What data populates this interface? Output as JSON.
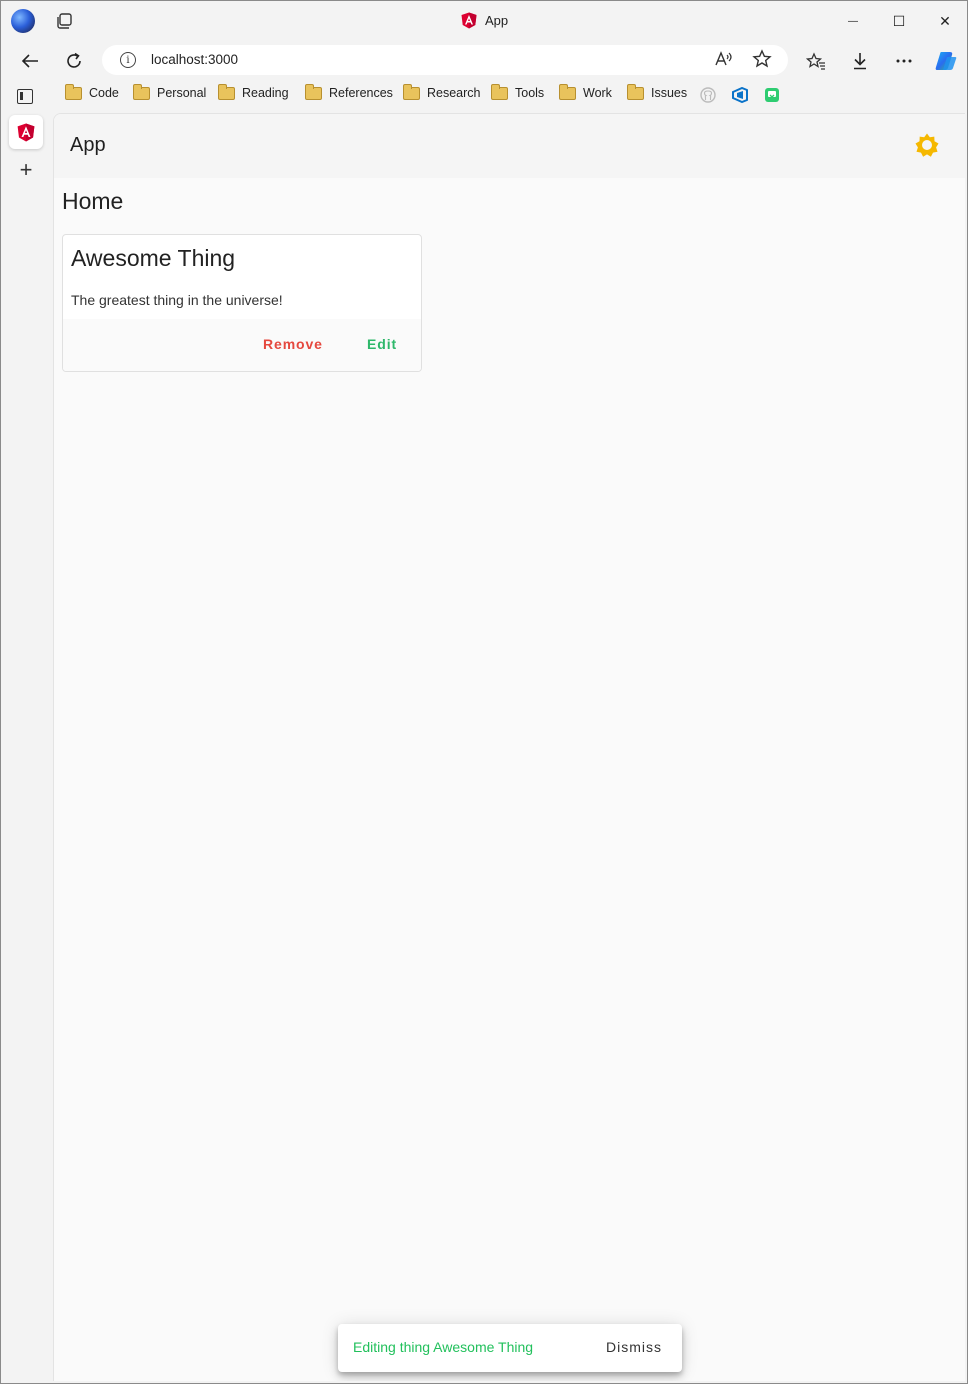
{
  "browser": {
    "tab_title": "App",
    "url": "localhost:3000",
    "window_controls": {
      "minimize": "—",
      "maximize": "☐",
      "close": "✕"
    },
    "bookmarks": [
      "Code",
      "Personal",
      "Reading",
      "References",
      "Research",
      "Tools",
      "Work",
      "Issues"
    ],
    "new_tab_glyph": "+"
  },
  "app": {
    "title": "App",
    "page_title": "Home",
    "card": {
      "title": "Awesome Thing",
      "description": "The greatest thing in the universe!",
      "remove_label": "Remove",
      "edit_label": "Edit"
    },
    "snackbar": {
      "message": "Editing thing Awesome Thing",
      "action_label": "Dismiss"
    }
  },
  "colors": {
    "remove": "#e5483e",
    "edit": "#2eb86a",
    "snackbar_message": "#22c05c",
    "theme_icon": "#f5b800",
    "angular_logo": "#dd0031"
  },
  "icons": [
    "profile-icon",
    "collections-icon",
    "angular-icon",
    "back-icon",
    "refresh-icon",
    "info-icon",
    "read-aloud-icon",
    "favorite-star-icon",
    "favorites-icon",
    "download-icon",
    "more-icon",
    "copilot-icon",
    "tab-actions-icon",
    "github-icon",
    "azure-devops-icon",
    "extension-icon",
    "sun-icon"
  ]
}
